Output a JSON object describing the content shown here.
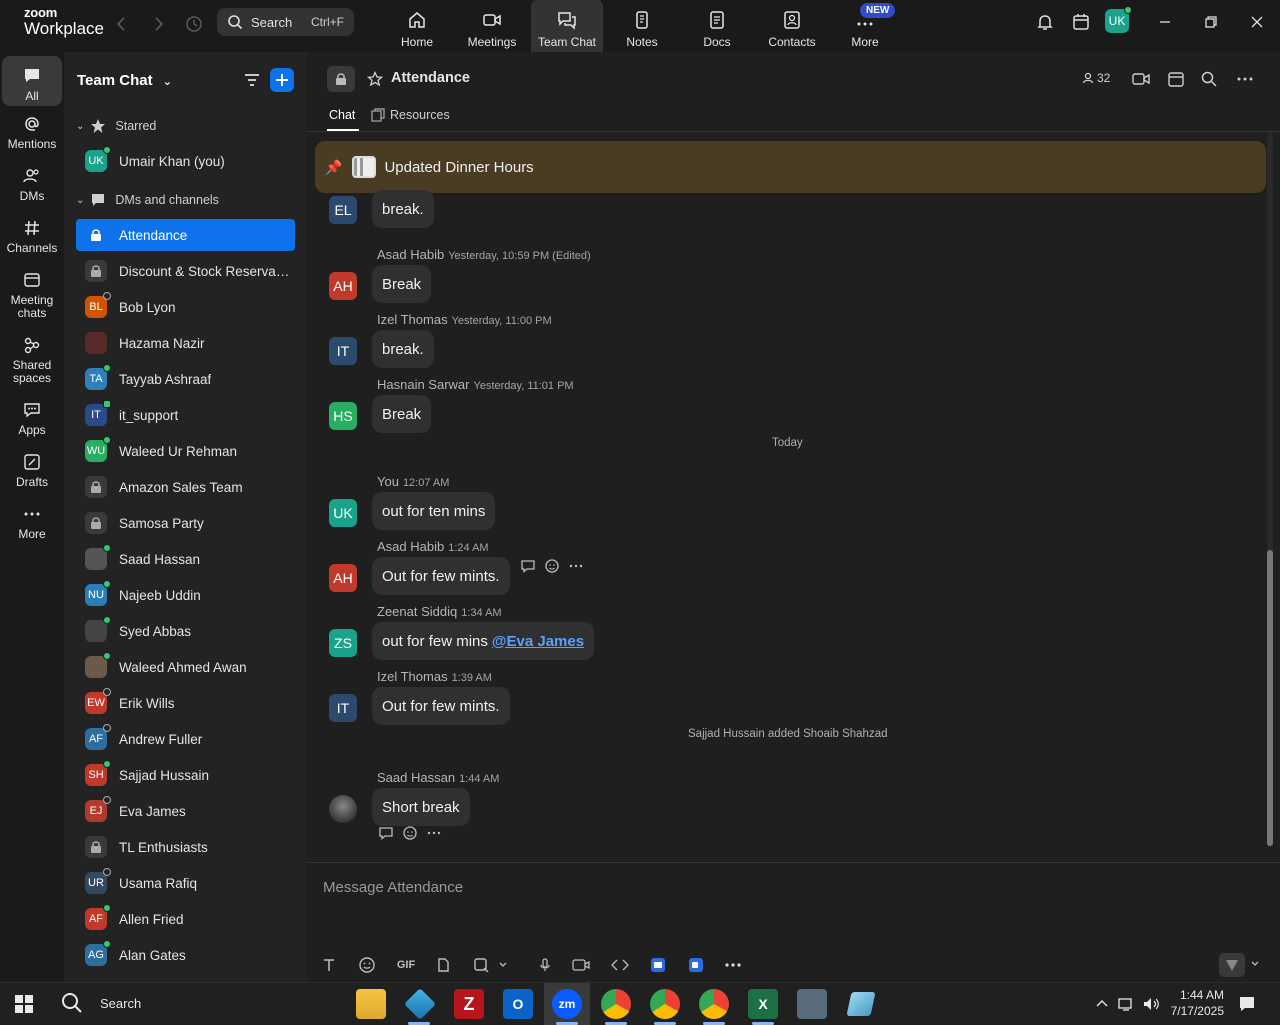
{
  "app": {
    "logo_line1": "zoom",
    "logo_line2": "Workplace"
  },
  "search": {
    "label": "Search",
    "shortcut": "Ctrl+F"
  },
  "nav_tabs": [
    {
      "label": "Home",
      "icon": "home-icon"
    },
    {
      "label": "Meetings",
      "icon": "video-icon"
    },
    {
      "label": "Team Chat",
      "icon": "chat-icon",
      "active": true
    },
    {
      "label": "Notes",
      "icon": "notes-icon"
    },
    {
      "label": "Docs",
      "icon": "docs-icon"
    },
    {
      "label": "Contacts",
      "icon": "contacts-icon"
    },
    {
      "label": "More",
      "icon": "more-icon",
      "badge": "NEW"
    }
  ],
  "user": {
    "initials": "UK",
    "status_color": "#2ecc71",
    "avatar_color": "#1aa38a"
  },
  "rail": [
    {
      "label": "All",
      "active": true
    },
    {
      "label": "Mentions"
    },
    {
      "label": "DMs"
    },
    {
      "label": "Channels"
    },
    {
      "label": "Meeting chats"
    },
    {
      "label": "Shared spaces"
    },
    {
      "label": "Apps"
    },
    {
      "label": "Drafts"
    },
    {
      "label": "More"
    }
  ],
  "sidebar": {
    "title": "Team Chat",
    "starred_label": "Starred",
    "starred": [
      {
        "label": "Umair Khan (you)",
        "initials": "UK",
        "color": "#1aa38a",
        "status": "online"
      }
    ],
    "dms_label": "DMs and channels",
    "items": [
      {
        "label": "Attendance",
        "type": "channel",
        "active": true
      },
      {
        "label": "Discount & Stock Reservati...",
        "type": "channel"
      },
      {
        "label": "Bob Lyon",
        "initials": "BL",
        "color": "#d35400",
        "status": "away"
      },
      {
        "label": "Hazama Nazir",
        "initials": "",
        "color": "#5a2a2a",
        "status": ""
      },
      {
        "label": "Tayyab Ashraaf",
        "initials": "TA",
        "color": "#2f7fb8",
        "status": "online"
      },
      {
        "label": "it_support",
        "initials": "IT",
        "color": "#2b4a8a",
        "status": "online-sq"
      },
      {
        "label": "Waleed Ur Rehman",
        "initials": "WU",
        "color": "#27ae60",
        "status": "online"
      },
      {
        "label": "Amazon Sales Team",
        "type": "channel"
      },
      {
        "label": "Samosa Party",
        "type": "channel"
      },
      {
        "label": "Saad Hassan",
        "initials": "",
        "color": "#555",
        "status": "online"
      },
      {
        "label": "Najeeb Uddin",
        "initials": "NU",
        "color": "#2980b9",
        "status": "online"
      },
      {
        "label": "Syed Abbas",
        "initials": "",
        "color": "#444",
        "status": "online"
      },
      {
        "label": "Waleed Ahmed Awan",
        "initials": "",
        "color": "#6b5a4a",
        "status": "online"
      },
      {
        "label": "Erik Wills",
        "initials": "EW",
        "color": "#c0392b",
        "status": "away"
      },
      {
        "label": "Andrew Fuller",
        "initials": "AF",
        "color": "#2c6e9e",
        "status": "away"
      },
      {
        "label": "Sajjad Hussain",
        "initials": "SH",
        "color": "#c0392b",
        "status": "online"
      },
      {
        "label": "Eva James",
        "initials": "EJ",
        "color": "#b03a2e",
        "status": "away"
      },
      {
        "label": "TL Enthusiasts",
        "type": "channel"
      },
      {
        "label": "Usama Rafiq",
        "initials": "UR",
        "color": "#34495e",
        "status": "away"
      },
      {
        "label": "Allen Fried",
        "initials": "AF",
        "color": "#c0392b",
        "status": "online"
      },
      {
        "label": "Alan Gates",
        "initials": "AG",
        "color": "#2c6e9e",
        "status": "online"
      }
    ]
  },
  "channel": {
    "title": "Attendance",
    "member_count": "32",
    "tabs": [
      {
        "label": "Chat",
        "active": true
      },
      {
        "label": "Resources"
      }
    ],
    "pinned": "Updated Dinner Hours"
  },
  "messages": [
    {
      "initials": "EL",
      "color": "#2c4a6e",
      "sender": "",
      "time": "",
      "text": "break."
    },
    {
      "initials": "AH",
      "color": "#c0392b",
      "sender": "Asad Habib",
      "time": "Yesterday, 10:59 PM (Edited)",
      "text": "Break"
    },
    {
      "initials": "IT",
      "color": "#2c4a6e",
      "sender": "Izel Thomas",
      "time": "Yesterday, 11:00 PM",
      "text": "break."
    },
    {
      "initials": "HS",
      "color": "#27ae60",
      "sender": "Hasnain Sarwar",
      "time": "Yesterday, 11:01 PM",
      "text": "Break"
    },
    {
      "initials": "UK",
      "color": "#1aa38a",
      "sender": "You",
      "time": "12:07 AM",
      "text": "out for ten mins"
    },
    {
      "initials": "AH",
      "color": "#c0392b",
      "sender": "Asad Habib",
      "time": "1:24 AM",
      "text": "Out for few mints."
    },
    {
      "initials": "ZS",
      "color": "#1aa38a",
      "sender": "Zeenat Siddiq",
      "time": "1:34 AM",
      "text": "out for few mins",
      "mention": "@Eva James"
    },
    {
      "initials": "IT",
      "color": "#2c4a6e",
      "sender": "Izel Thomas",
      "time": "1:39 AM",
      "text": "Out for few mints."
    },
    {
      "initials": "",
      "color": "#444",
      "sender": "Saad Hassan",
      "time": "1:44 AM",
      "text": "Short break"
    }
  ],
  "divider_today": "Today",
  "system_message": "Sajjad Hussain added Shoaib Shahzad",
  "composer": {
    "placeholder": "Message Attendance",
    "gif_label": "GIF"
  },
  "taskbar": {
    "search_label": "Search",
    "time": "1:44 AM",
    "date": "7/17/2025"
  }
}
